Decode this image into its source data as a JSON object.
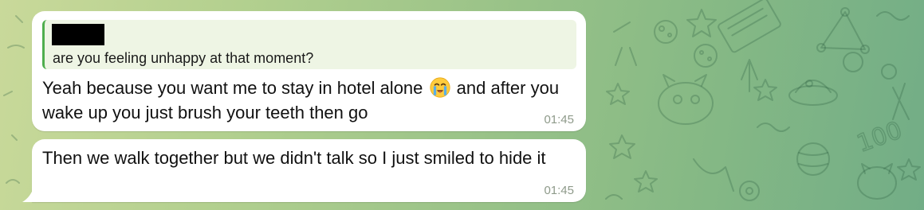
{
  "chat": {
    "messages": [
      {
        "reply_quote_text": "are you feeling unhappy at that moment?",
        "reply_author_redacted": true,
        "text_before_emoji": "Yeah because you want me to stay in hotel alone",
        "emoji": "loudly-crying-face",
        "text_after_emoji": "and after you wake up you just brush your teeth then go",
        "time": "01:45"
      },
      {
        "text": "Then we walk together but we didn't talk so I just smiled to hide it",
        "time": "01:45"
      }
    ]
  },
  "colors": {
    "bubble_background": "#ffffff",
    "reply_accent": "#4fae4e",
    "reply_background": "#eef5e4",
    "timestamp": "#8e9a8a",
    "wallpaper_left": "#c9d99a",
    "wallpaper_right": "#72ad86"
  }
}
